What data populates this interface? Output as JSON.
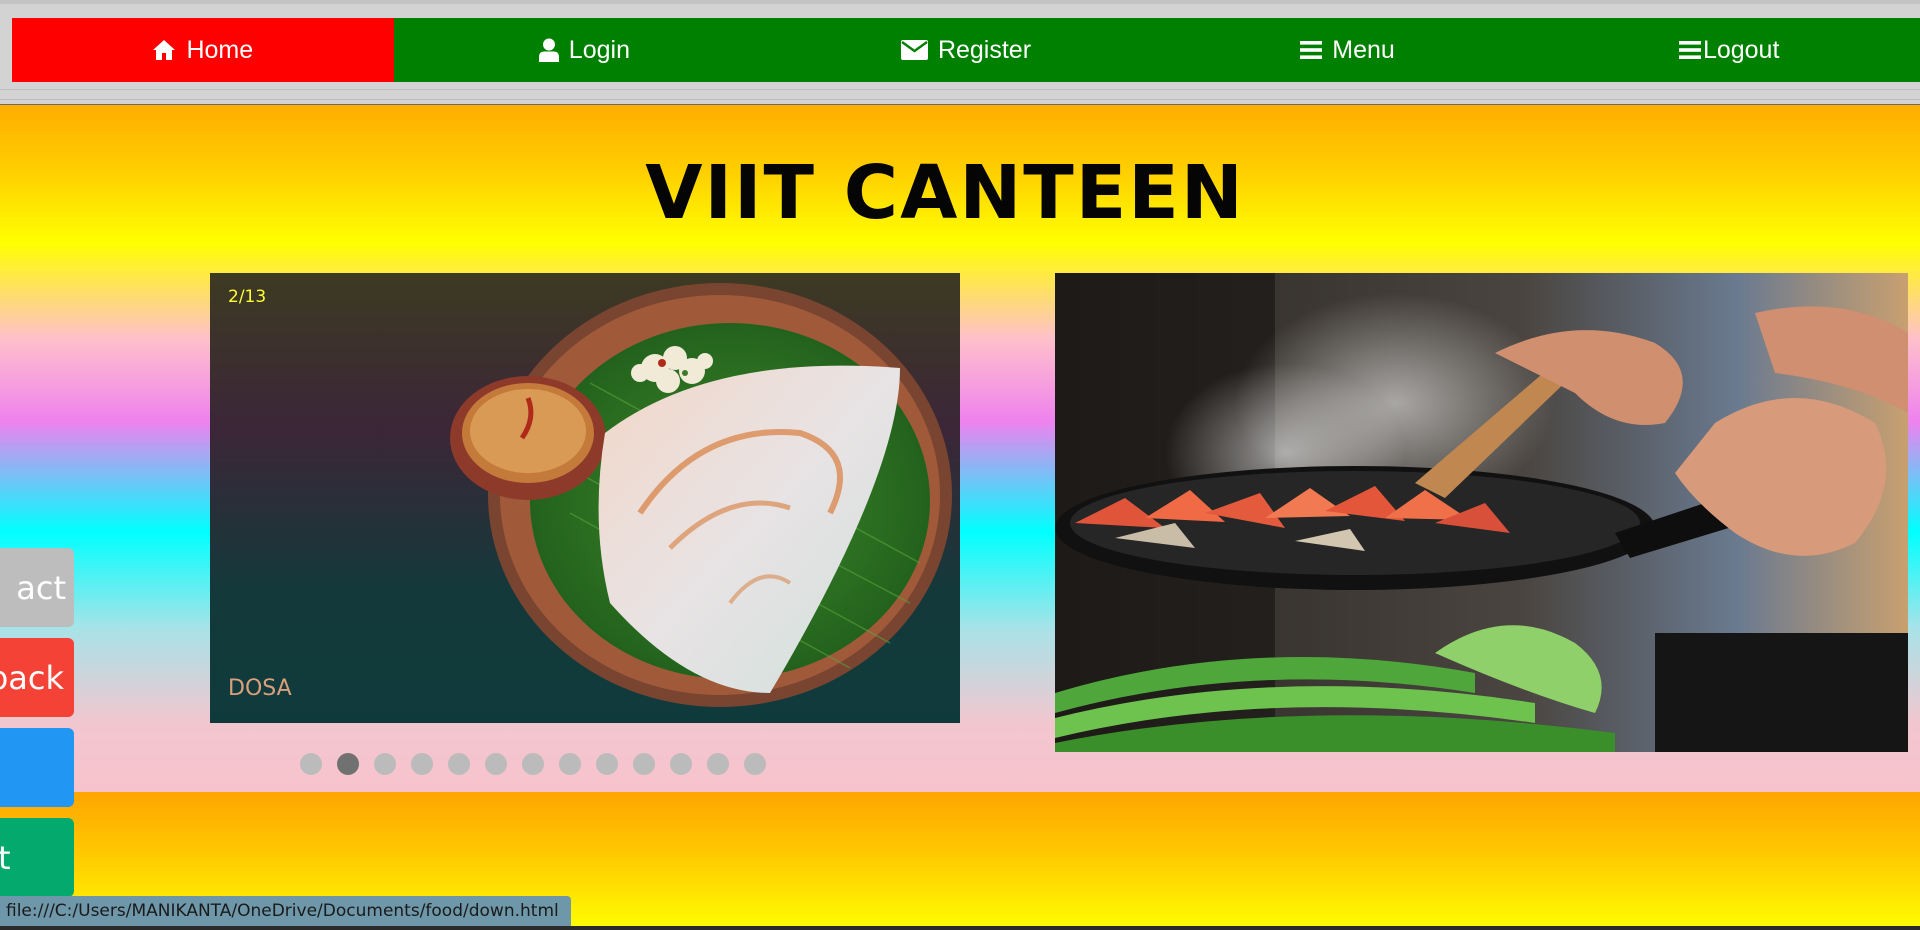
{
  "nav": {
    "items": [
      {
        "label": "Home",
        "icon": "home-icon",
        "active": true
      },
      {
        "label": "Login",
        "icon": "user-icon",
        "active": false
      },
      {
        "label": "Register",
        "icon": "envelope-icon",
        "active": false
      },
      {
        "label": "Menu",
        "icon": "bars-icon",
        "active": false
      },
      {
        "label": "Logout",
        "icon": "bars-icon",
        "active": false
      }
    ],
    "colors": {
      "bar": "#008000",
      "active": "#ff0000",
      "text": "#ffffff"
    }
  },
  "page": {
    "title": "VIIT CANTEEN"
  },
  "slideshow": {
    "counter": "2/13",
    "caption": "DOSA",
    "total_slides": 13,
    "current_slide": 2
  },
  "side_buttons": [
    {
      "label": "Contact",
      "visible_text": "act",
      "color": "#bdbdbd"
    },
    {
      "label": "Feedback",
      "visible_text": "back",
      "color": "#f44336"
    },
    {
      "label": "",
      "visible_text": "",
      "color": "#2196f3"
    },
    {
      "label": "",
      "visible_text": "t",
      "color": "#04aa6d"
    }
  ],
  "statusbar": {
    "text": "file:///C:/Users/MANIKANTA/OneDrive/Documents/food/down.html"
  }
}
